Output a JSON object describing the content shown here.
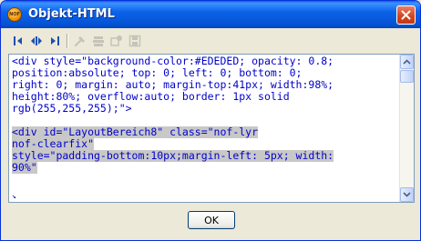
{
  "window": {
    "title": "Objekt-HTML",
    "app_icon_text": "NOF"
  },
  "toolbar": {
    "buttons": [
      {
        "icon": "jump-to-start-icon",
        "enabled": true
      },
      {
        "icon": "jump-to-tag-icon",
        "enabled": true
      },
      {
        "icon": "jump-to-end-icon",
        "enabled": true
      },
      {
        "icon": "hammer-icon",
        "enabled": false
      },
      {
        "icon": "stack-icon",
        "enabled": false
      },
      {
        "icon": "settings-icon",
        "enabled": false
      },
      {
        "icon": "save-icon",
        "enabled": false
      }
    ]
  },
  "editor": {
    "lines": [
      {
        "text": "<div style=\"background-color:#EDEDED; opacity: 0.8;",
        "selected": false
      },
      {
        "text": "position:absolute; top: 0; left: 0; bottom: 0;",
        "selected": false
      },
      {
        "text": "right: 0; margin: auto; margin-top:41px; width:98%;",
        "selected": false
      },
      {
        "text": "height:80%; overflow:auto; border: 1px solid",
        "selected": false
      },
      {
        "text": "rgb(255,255,255);\">",
        "selected": false
      },
      {
        "text": "",
        "selected": false
      },
      {
        "text": "<div id=\"LayoutBereich8\" class=\"nof-lyr",
        "selected": true
      },
      {
        "text": "nof-clearfix\"",
        "selected": true
      },
      {
        "text": "style=\"padding-bottom:10px;margin-left: 5px; width:",
        "selected": true
      },
      {
        "text": "90%\"",
        "selected": true
      },
      {
        "text": "",
        "selected": false
      },
      {
        "text": "",
        "selected": false
      },
      {
        "text": "↘",
        "selected": false
      }
    ]
  },
  "dialog": {
    "ok_label": "OK"
  },
  "colors": {
    "title_bar": "#0552d4",
    "code_text": "#0000cc",
    "selection": "#c8c8c8",
    "dialog_background": "#ece9d8"
  }
}
